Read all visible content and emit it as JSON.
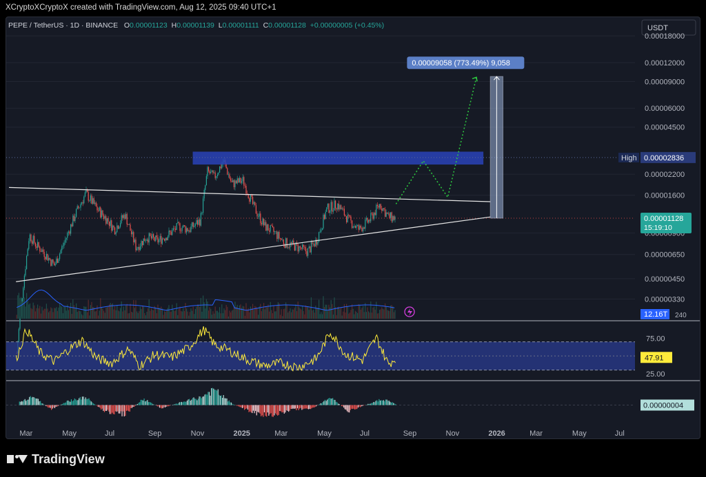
{
  "header": {
    "credit": "XCryptoXCryptoX created with TradingView.com, Aug 12, 2025 09:40 UTC+1"
  },
  "symbol": {
    "name": "PEPE / TetherUS · 1D · BINANCE",
    "o_label": "O",
    "o": "0.00001123",
    "h_label": "H",
    "h": "0.00001139",
    "l_label": "L",
    "l": "0.00001111",
    "c_label": "C",
    "c": "0.00001128",
    "change": "+0.00000005 (+0.45%)"
  },
  "colors": {
    "up": "#26a69a",
    "down": "#ef5350",
    "zone": "#2943b8",
    "rsi": "#ffeb3b",
    "ma": "#2962ff"
  },
  "chart_data": {
    "type": "line",
    "title": "PEPE / TetherUS · 1D · BINANCE",
    "currency_button": "USDT",
    "y_scale": "log",
    "y_ticks": [
      "0.00018000",
      "0.00012000",
      "0.00009000",
      "0.00006000",
      "0.00004500",
      "0.00002200",
      "0.00001600",
      "0.00000900",
      "0.00000650",
      "0.00000450",
      "0.00000330"
    ],
    "y_range": [
      2.4e-06,
      0.00022
    ],
    "x_ticks": [
      "Mar",
      "May",
      "Jul",
      "Sep",
      "Nov",
      "2025",
      "Mar",
      "May",
      "Jul",
      "Sep",
      "Nov",
      "2026",
      "Mar",
      "May",
      "Jul"
    ],
    "x_ticks_bold": [
      "2025",
      "2026"
    ],
    "price_series": {
      "name": "PEPE/USDT close (approx.)",
      "x": [
        "2024-02-15",
        "2024-02-25",
        "2024-03-05",
        "2024-03-15",
        "2024-03-25",
        "2024-04-10",
        "2024-04-25",
        "2024-05-10",
        "2024-05-25",
        "2024-06-10",
        "2024-06-25",
        "2024-07-05",
        "2024-07-20",
        "2024-08-05",
        "2024-08-20",
        "2024-09-05",
        "2024-09-20",
        "2024-10-05",
        "2024-10-20",
        "2024-11-05",
        "2024-11-15",
        "2024-11-25",
        "2024-12-08",
        "2024-12-20",
        "2025-01-05",
        "2025-01-20",
        "2025-02-05",
        "2025-02-20",
        "2025-03-05",
        "2025-03-20",
        "2025-04-07",
        "2025-04-20",
        "2025-05-05",
        "2025-05-20",
        "2025-06-05",
        "2025-06-20",
        "2025-07-05",
        "2025-07-20",
        "2025-08-01",
        "2025-08-12"
      ],
      "y": [
        1.3e-06,
        4e-06,
        8.8e-06,
        7.5e-06,
        6.8e-06,
        5.5e-06,
        8e-06,
        1.2e-05,
        1.65e-05,
        1.3e-05,
        1.1e-05,
        9.5e-06,
        1.2e-05,
        7.2e-06,
        8.5e-06,
        8e-06,
        8.8e-06,
        1e-05,
        9.5e-06,
        1.1e-05,
        2.3e-05,
        2.1e-05,
        2.7e-05,
        1.9e-05,
        2e-05,
        1.35e-05,
        1e-05,
        9e-06,
        7.8e-06,
        7.4e-06,
        6.8e-06,
        8e-06,
        1.3e-05,
        1.4e-05,
        1.1e-05,
        9.5e-06,
        1.1e-05,
        1.4e-05,
        1.15e-05,
        1.13e-05
      ]
    },
    "resistance_zone": {
      "from": "2024-10-25",
      "to": "2025-12-15",
      "y_low": 2.55e-05,
      "y_high": 3.1e-05
    },
    "triangle_upper": [
      [
        "2024-02-05",
        1.8e-05
      ],
      [
        "2025-12-25",
        1.45e-05
      ]
    ],
    "triangle_lower": [
      [
        "2024-02-15",
        4.3e-06
      ],
      [
        "2025-12-25",
        1.15e-05
      ]
    ],
    "projection_path": [
      [
        "2025-08-12",
        1.4e-05
      ],
      [
        "2025-09-20",
        2.7e-05
      ],
      [
        "2025-10-25",
        1.55e-05
      ],
      [
        "2025-12-05",
        9.6e-05
      ]
    ],
    "measure_box": {
      "from": "2025-12-25",
      "to": "2026-01-12",
      "y_low": 1.13e-05,
      "y_high": 9.71e-05,
      "label": "0.00009058 (773.49%) 9,058"
    },
    "price_tags": [
      {
        "label": "High",
        "value": "0.00002836",
        "y": 2.836e-05,
        "color": "#2a3b7a"
      },
      {
        "value": "0.00001128",
        "sub": "15:19:10",
        "y": 1.128e-05,
        "color": "#26a69a"
      }
    ],
    "volume_tag": "12.16T",
    "rsi": {
      "ticks": [
        "75.00",
        "25.00"
      ],
      "band": [
        30,
        70
      ],
      "value": "47.91",
      "x": [
        "2024-02-15",
        "2024-03-01",
        "2024-03-20",
        "2024-04-10",
        "2024-05-01",
        "2024-05-20",
        "2024-06-10",
        "2024-07-01",
        "2024-07-25",
        "2024-08-10",
        "2024-09-01",
        "2024-09-25",
        "2024-10-20",
        "2024-11-10",
        "2024-11-25",
        "2024-12-15",
        "2025-01-10",
        "2025-02-05",
        "2025-03-01",
        "2025-03-25",
        "2025-04-20",
        "2025-05-10",
        "2025-06-01",
        "2025-06-25",
        "2025-07-15",
        "2025-08-01",
        "2025-08-12"
      ],
      "y": [
        45,
        88,
        55,
        42,
        60,
        72,
        46,
        40,
        60,
        36,
        52,
        48,
        62,
        88,
        66,
        58,
        45,
        36,
        40,
        34,
        46,
        84,
        52,
        44,
        76,
        38,
        47.91
      ]
    },
    "macd": {
      "value": "0.00000004",
      "x": [
        "2024-02-20",
        "2024-03-10",
        "2024-04-05",
        "2024-05-01",
        "2024-05-25",
        "2024-06-20",
        "2024-07-20",
        "2024-08-15",
        "2024-09-10",
        "2024-10-10",
        "2024-11-05",
        "2024-11-25",
        "2024-12-20",
        "2025-01-20",
        "2025-02-15",
        "2025-03-15",
        "2025-04-15",
        "2025-05-10",
        "2025-06-05",
        "2025-07-05",
        "2025-07-25",
        "2025-08-12"
      ],
      "y": [
        0.2,
        0.6,
        -0.3,
        0.3,
        0.5,
        -0.4,
        -0.6,
        0.4,
        -0.2,
        0.2,
        0.5,
        1.0,
        0.1,
        -0.5,
        -0.7,
        -0.3,
        -0.2,
        0.5,
        -0.4,
        0.1,
        0.4,
        0.05
      ]
    }
  }
}
